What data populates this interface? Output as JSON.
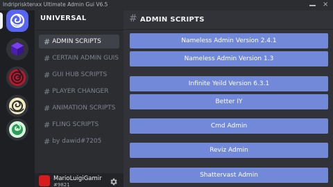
{
  "window": {
    "title": "Indriprisktenxx Ultimate Admin Gui V6.5",
    "minimize_icon": "minimize-icon",
    "close_icon": "close-icon",
    "close_glyph": "×"
  },
  "servers": [
    {
      "name": "server-1",
      "icon": "swirl-icon",
      "active": true
    },
    {
      "name": "server-2",
      "icon": "purple-cube-icon",
      "active": false
    },
    {
      "name": "server-3",
      "icon": "red-swirl-icon",
      "active": false
    },
    {
      "name": "server-4",
      "icon": "yellow-swirl-icon",
      "active": false
    },
    {
      "name": "server-5",
      "icon": "green-swirl-icon",
      "active": false
    }
  ],
  "sidebar": {
    "guild_name": "UNIVERSAL",
    "channels": [
      {
        "label": "ADMIN SCRIPTS",
        "active": true
      },
      {
        "label": "CERTAIN ADMIN GUIS",
        "active": false
      },
      {
        "label": "GUI HUB SCRIPTS",
        "active": false
      },
      {
        "label": "PLAYER CHANGER",
        "active": false
      },
      {
        "label": "ANIMATION SCRIPTS",
        "active": false
      },
      {
        "label": "FLING SCRIPTS",
        "active": false
      },
      {
        "label": "by dawid#7205",
        "active": false
      }
    ],
    "hash_glyph": "#"
  },
  "user": {
    "name": "MarioLuigiGamir",
    "tag": "#9821",
    "avatar_color": "#d81b1b",
    "settings_icon": "gear-icon"
  },
  "main": {
    "channel_title": "ADMIN SCRIPTS",
    "hash_glyph": "#",
    "buttons": [
      {
        "label": "Nameless Admin Version 2.4.1"
      },
      {
        "label": "Nameless Admin Version 1.3"
      },
      {
        "label": "Infinite Yeild Version 6.3.1"
      },
      {
        "label": "Better IY"
      },
      {
        "label": "Cmd Admin"
      },
      {
        "label": "Reviz Admin"
      },
      {
        "label": "Shattervast Admin"
      }
    ]
  },
  "colors": {
    "accent": "#5865f2",
    "button": "#7289da",
    "background": "#313338",
    "sidebar": "#2b2d31",
    "rail": "#1e1f22"
  }
}
